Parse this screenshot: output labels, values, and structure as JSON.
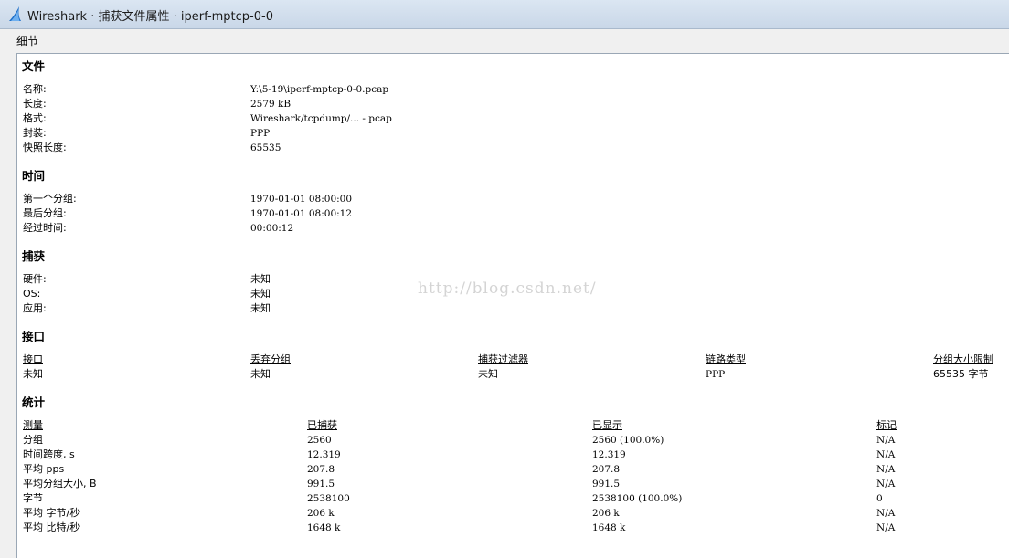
{
  "window": {
    "title": "Wireshark · 捕获文件属性 · iperf-mptcp-0-0",
    "icon": "wireshark-fin-icon"
  },
  "menu": {
    "details_label": "细节"
  },
  "file": {
    "title": "文件",
    "rows": [
      {
        "label": "名称:",
        "value": "Y:\\5-19\\iperf-mptcp-0-0.pcap"
      },
      {
        "label": "长度:",
        "value": "2579 kB"
      },
      {
        "label": "格式:",
        "value": "Wireshark/tcpdump/... - pcap"
      },
      {
        "label": "封装:",
        "value": "PPP"
      },
      {
        "label": "快照长度:",
        "value": "65535"
      }
    ]
  },
  "time": {
    "title": "时间",
    "rows": [
      {
        "label": "第一个分组:",
        "value": "1970-01-01 08:00:00"
      },
      {
        "label": "最后分组:",
        "value": "1970-01-01 08:00:12"
      },
      {
        "label": "经过时间:",
        "value": "00:00:12"
      }
    ]
  },
  "capture": {
    "title": "捕获",
    "rows": [
      {
        "label": "硬件:",
        "value": "未知"
      },
      {
        "label": "OS:",
        "value": "未知"
      },
      {
        "label": "应用:",
        "value": "未知"
      }
    ]
  },
  "interfaces": {
    "title": "接口",
    "headers": [
      "接口",
      "丢弃分组",
      "捕获过滤器",
      "链路类型",
      "分组大小限制"
    ],
    "rows": [
      [
        "未知",
        "未知",
        "未知",
        "PPP",
        "65535 字节"
      ]
    ]
  },
  "statistics": {
    "title": "统计",
    "headers": [
      "测量",
      "已捕获",
      "已显示",
      "标记"
    ],
    "rows": [
      [
        "分组",
        "2560",
        "2560 (100.0%)",
        "N/A"
      ],
      [
        "时间跨度, s",
        "12.319",
        "12.319",
        "N/A"
      ],
      [
        "平均 pps",
        "207.8",
        "207.8",
        "N/A"
      ],
      [
        "平均分组大小, B",
        "991.5",
        "991.5",
        "N/A"
      ],
      [
        "字节",
        "2538100",
        "2538100 (100.0%)",
        "0"
      ],
      [
        "平均 字节/秒",
        "206 k",
        "206 k",
        "N/A"
      ],
      [
        "平均 比特/秒",
        "1648 k",
        "1648 k",
        "N/A"
      ]
    ]
  },
  "watermark": "http://blog.csdn.net/"
}
